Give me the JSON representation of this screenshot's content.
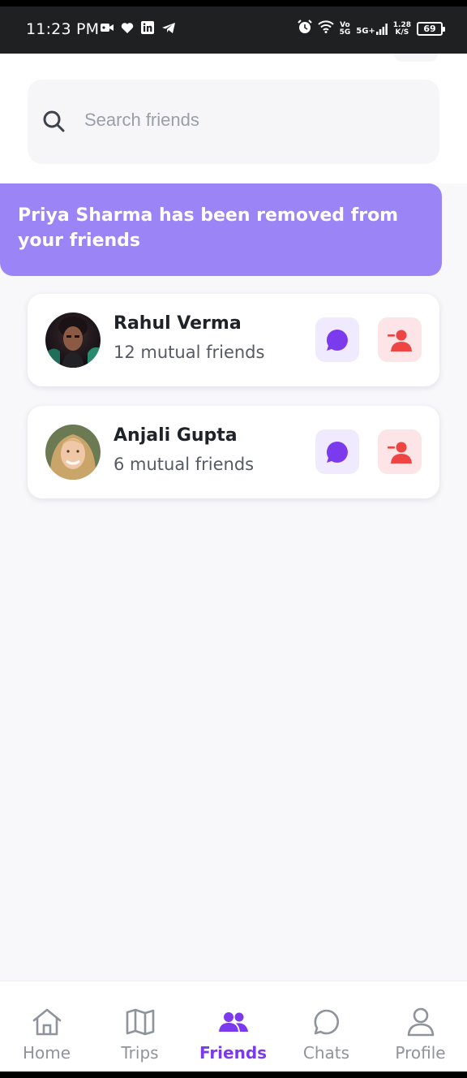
{
  "status_bar": {
    "time": "11:23 PM",
    "network_top": "Vo",
    "network_bottom": "5G",
    "signal_label": "5G+",
    "speed_value": "1.28",
    "speed_unit": "K/S",
    "battery": "69"
  },
  "search": {
    "placeholder": "Search friends",
    "value": ""
  },
  "toast": {
    "message": "Priya Sharma has been removed from your friends",
    "color": "#9b85f6"
  },
  "friends": [
    {
      "name": "Rahul Verma",
      "mutual": "12 mutual friends",
      "avatar_icon": "avatar-photo-rahul"
    },
    {
      "name": "Anjali Gupta",
      "mutual": "6 mutual friends",
      "avatar_icon": "avatar-photo-anjali"
    }
  ],
  "actions": {
    "chat_icon": "chat-bubble-icon",
    "remove_icon": "remove-user-icon",
    "chat_bg": "#efeafd",
    "remove_bg": "#fde4e6"
  },
  "nav": {
    "active": "Friends",
    "active_color": "#7c3aed",
    "items": [
      {
        "label": "Home",
        "icon": "home-icon"
      },
      {
        "label": "Trips",
        "icon": "map-icon"
      },
      {
        "label": "Friends",
        "icon": "friends-icon"
      },
      {
        "label": "Chats",
        "icon": "chat-icon"
      },
      {
        "label": "Profile",
        "icon": "profile-icon"
      }
    ]
  }
}
